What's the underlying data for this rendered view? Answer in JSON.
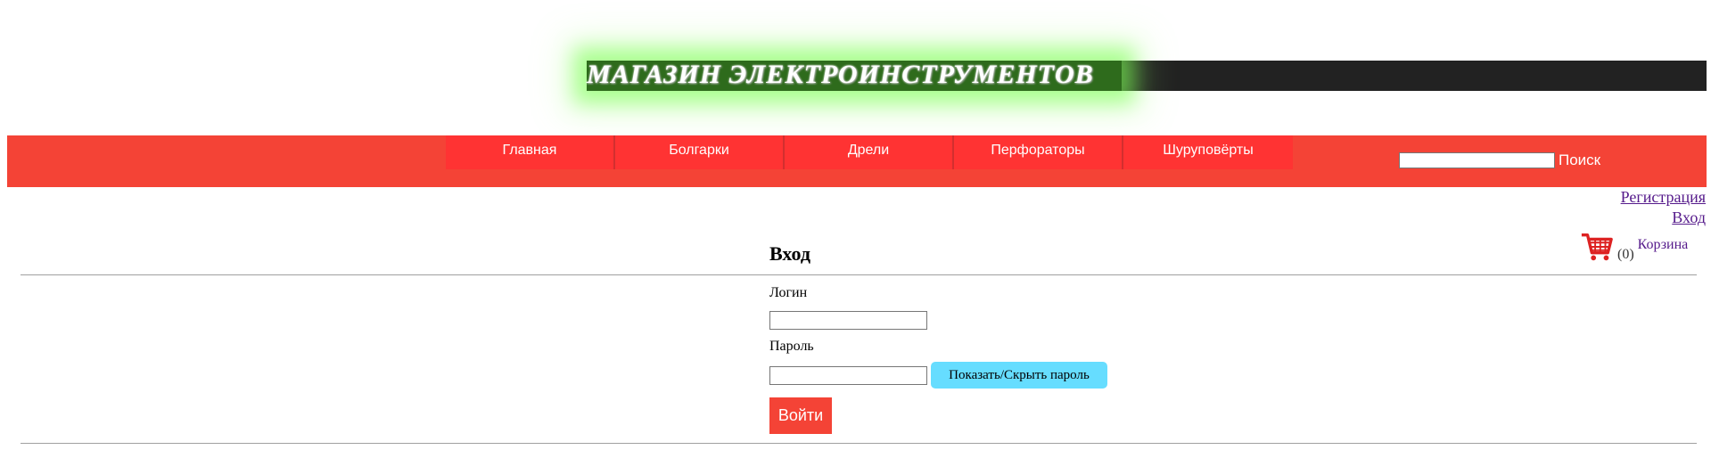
{
  "header": {
    "title": "МАГАЗИН ЭЛЕКТРОИНСТРУМЕНТОВ"
  },
  "nav": {
    "items": [
      {
        "label": "Главная"
      },
      {
        "label": "Болгарки"
      },
      {
        "label": "Дрели"
      },
      {
        "label": "Перфораторы"
      },
      {
        "label": "Шуруповёрты"
      }
    ]
  },
  "search": {
    "value": "",
    "button_label": "Поиск"
  },
  "account": {
    "register_label": "Регистрация",
    "login_label": "Вход"
  },
  "cart": {
    "icon": "shopping-cart-icon",
    "count": "(0)",
    "label": "Корзина"
  },
  "login_form": {
    "heading": "Вход",
    "login_label": "Логин",
    "login_value": "",
    "password_label": "Пароль",
    "password_value": "",
    "toggle_password_label": "Показать/Скрыть пароль",
    "submit_label": "Войти"
  },
  "colors": {
    "nav_background": "#f44336",
    "nav_item_background": "#ff3333",
    "banner_glow": "#7cff50",
    "toggle_button": "#66ddff",
    "link": "#551a8b"
  }
}
